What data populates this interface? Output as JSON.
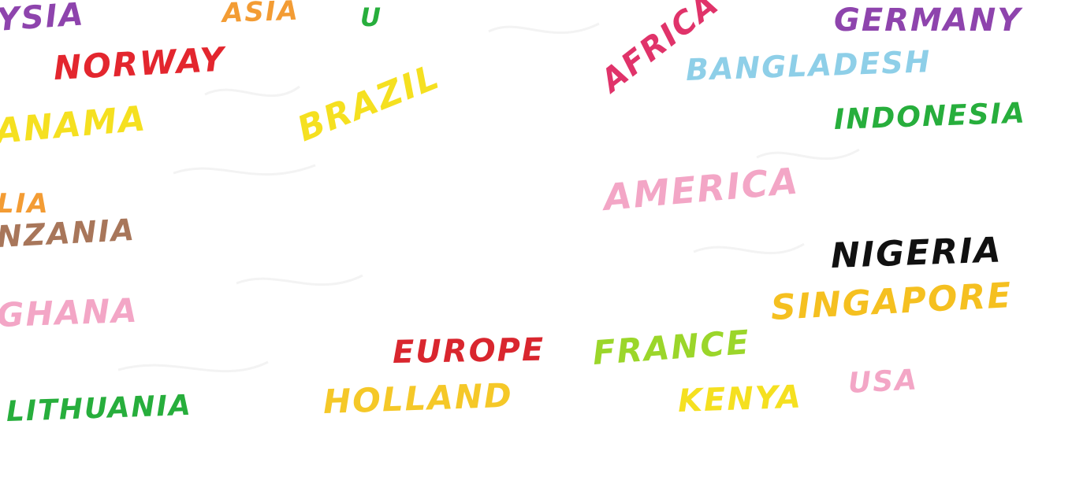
{
  "words": [
    {
      "text": "YSIA",
      "color": "#8e44ad"
    },
    {
      "text": "ASIA",
      "color": "#f39c34"
    },
    {
      "text": "U",
      "color": "#27ae3c"
    },
    {
      "text": "AFRICA",
      "color": "#e0336a"
    },
    {
      "text": "GERMANY",
      "color": "#8e44ad"
    },
    {
      "text": "NORWAY",
      "color": "#e3262e"
    },
    {
      "text": "BANGLADESH",
      "color": "#8ecfe8"
    },
    {
      "text": "BRAZIL",
      "color": "#f5e020"
    },
    {
      "text": "ANAMA",
      "color": "#f5e020"
    },
    {
      "text": "INDONESIA",
      "color": "#27ae3c"
    },
    {
      "text": "AMERICA",
      "color": "#f3a6c6"
    },
    {
      "text": "LIA",
      "color": "#f39c34"
    },
    {
      "text": "NZANIA",
      "color": "#a8765a"
    },
    {
      "text": "NIGERIA",
      "color": "#111111"
    },
    {
      "text": "GHANA",
      "color": "#f3a6c6"
    },
    {
      "text": "SINGAPORE",
      "color": "#f5c020"
    },
    {
      "text": "EUROPE",
      "color": "#d9262e"
    },
    {
      "text": "FRANCE",
      "color": "#9bd62a"
    },
    {
      "text": "USA",
      "color": "#f3a6c6"
    },
    {
      "text": "HOLLAND",
      "color": "#f5c828"
    },
    {
      "text": "KENYA",
      "color": "#f5e020"
    },
    {
      "text": "LITHUANIA",
      "color": "#27ae3c"
    }
  ]
}
